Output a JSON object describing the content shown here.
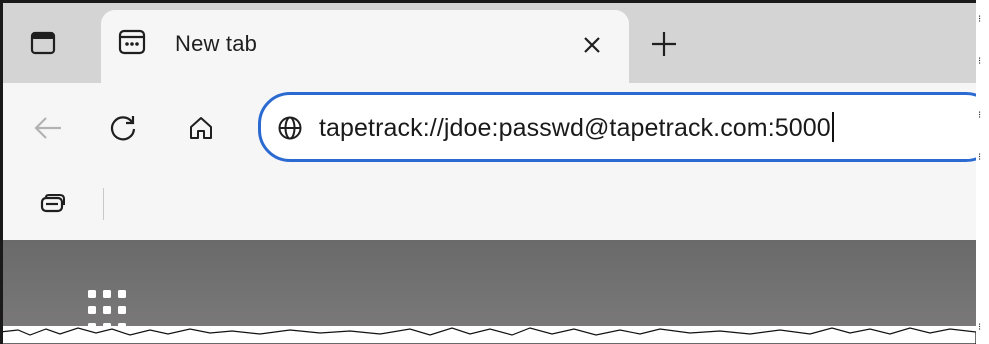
{
  "tab": {
    "title": "New tab",
    "close_label": "×",
    "new_tab_label": "+"
  },
  "toolbar": {
    "back_icon": "back-arrow-icon",
    "refresh_icon": "refresh-icon",
    "home_icon": "home-icon"
  },
  "address": {
    "site_icon": "globe-icon",
    "url": "tapetrack://jdoe:passwd@tapetrack.com:5000"
  },
  "favorites": {
    "collections_icon": "collections-icon"
  },
  "newtab_page": {
    "apps_icon": "app-launcher-icon"
  },
  "colors": {
    "accent": "#2b6bd1",
    "tabbar": "#d4d4d4",
    "toolbar": "#f6f6f6"
  }
}
